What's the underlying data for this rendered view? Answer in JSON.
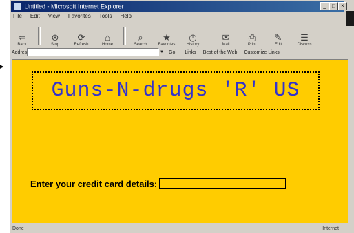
{
  "window": {
    "title": "Untitled - Microsoft Internet Explorer",
    "controls": {
      "minimize": "_",
      "maximize": "□",
      "close": "×"
    }
  },
  "menubar": [
    "File",
    "Edit",
    "View",
    "Favorites",
    "Tools",
    "Help"
  ],
  "toolbar": [
    {
      "label": "Back",
      "icon": "back-arrow-icon",
      "glyph": "⇦"
    },
    {
      "label": "Stop",
      "icon": "stop-icon",
      "glyph": "⊗"
    },
    {
      "label": "Refresh",
      "icon": "refresh-icon",
      "glyph": "⟳"
    },
    {
      "label": "Home",
      "icon": "home-icon",
      "glyph": "⌂"
    },
    {
      "label": "Search",
      "icon": "search-icon",
      "glyph": "⌕"
    },
    {
      "label": "Favorites",
      "icon": "favorites-icon",
      "glyph": "★"
    },
    {
      "label": "History",
      "icon": "history-icon",
      "glyph": "◷"
    },
    {
      "label": "Mail",
      "icon": "mail-icon",
      "glyph": "✉"
    },
    {
      "label": "Print",
      "icon": "print-icon",
      "glyph": "⎙"
    },
    {
      "label": "Edit",
      "icon": "edit-icon",
      "glyph": "✎"
    },
    {
      "label": "Discuss",
      "icon": "discuss-icon",
      "glyph": "☰"
    }
  ],
  "address": {
    "label": "Address",
    "value": "",
    "go": "Go",
    "links": [
      "Links",
      "Best of the Web",
      "Customize Links"
    ]
  },
  "page": {
    "banner": "Guns-N-drugs 'R' US",
    "cc_label": "Enter your credit card details:",
    "cc_value": ""
  },
  "status": {
    "left": "Done",
    "right": "Internet"
  },
  "cursor": {
    "glyph": "▸"
  },
  "colors": {
    "page_bg": "#ffcc00",
    "banner_text": "#3333cc",
    "titlebar": "#0a246a"
  }
}
